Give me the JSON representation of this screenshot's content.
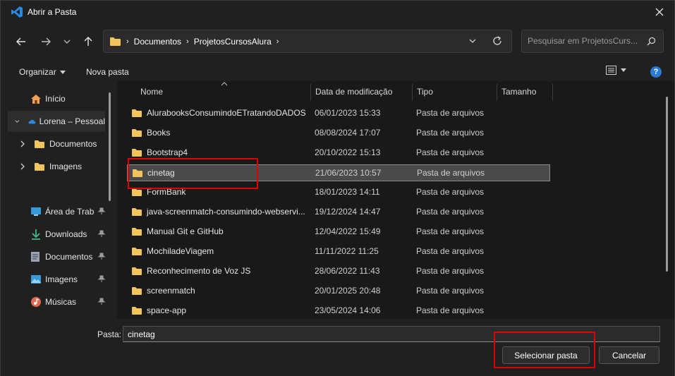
{
  "window": {
    "title": "Abrir a Pasta"
  },
  "address": {
    "crumbs": [
      "Documentos",
      "ProjetosCursosAlura"
    ]
  },
  "search": {
    "placeholder": "Pesquisar em ProjetosCurs..."
  },
  "toolbar": {
    "organize_label": "Organizar",
    "new_folder_label": "Nova pasta",
    "help_label": "?"
  },
  "sidebar": {
    "items": [
      {
        "label": "Início",
        "icon": "home-icon"
      },
      {
        "label": "Lorena – Pessoal",
        "icon": "onedrive-icon"
      },
      {
        "label": "Documentos",
        "icon": "folder-icon"
      },
      {
        "label": "Imagens",
        "icon": "folder-icon"
      },
      {
        "label": "Área de Trabalho",
        "icon": "desktop-icon"
      },
      {
        "label": "Downloads",
        "icon": "download-icon"
      },
      {
        "label": "Documentos",
        "icon": "documents-icon"
      },
      {
        "label": "Imagens",
        "icon": "pictures-icon"
      },
      {
        "label": "Músicas",
        "icon": "music-icon"
      }
    ]
  },
  "columns": {
    "name": "Nome",
    "date": "Data de modificação",
    "type": "Tipo",
    "size": "Tamanho"
  },
  "files": [
    {
      "name": "AlurabooksConsumindoETratandoDADOS",
      "date": "06/01/2023 15:33",
      "type": "Pasta de arquivos"
    },
    {
      "name": "Books",
      "date": "08/08/2024 17:07",
      "type": "Pasta de arquivos"
    },
    {
      "name": "Bootstrap4",
      "date": "20/10/2022 15:13",
      "type": "Pasta de arquivos"
    },
    {
      "name": "cinetag",
      "date": "21/06/2023 10:57",
      "type": "Pasta de arquivos"
    },
    {
      "name": "FormBank",
      "date": "18/01/2023 14:11",
      "type": "Pasta de arquivos"
    },
    {
      "name": "java-screenmatch-consumindo-webservi...",
      "date": "19/12/2024 14:47",
      "type": "Pasta de arquivos"
    },
    {
      "name": "Manual Git e GitHub",
      "date": "12/04/2022 15:49",
      "type": "Pasta de arquivos"
    },
    {
      "name": "MochiladeViagem",
      "date": "11/11/2022 11:25",
      "type": "Pasta de arquivos"
    },
    {
      "name": "Reconhecimento de Voz JS",
      "date": "28/06/2022 11:43",
      "type": "Pasta de arquivos"
    },
    {
      "name": "screenmatch",
      "date": "20/01/2025 20:48",
      "type": "Pasta de arquivos"
    },
    {
      "name": "space-app",
      "date": "23/05/2024 14:06",
      "type": "Pasta de arquivos"
    }
  ],
  "footer": {
    "folder_label": "Pasta:",
    "folder_value": "cinetag",
    "select_button": "Selecionar pasta",
    "cancel_button": "Cancelar"
  },
  "colors": {
    "accent": "#2a7bd4",
    "folder": "#f2c55c",
    "highlight": "#e00000"
  }
}
